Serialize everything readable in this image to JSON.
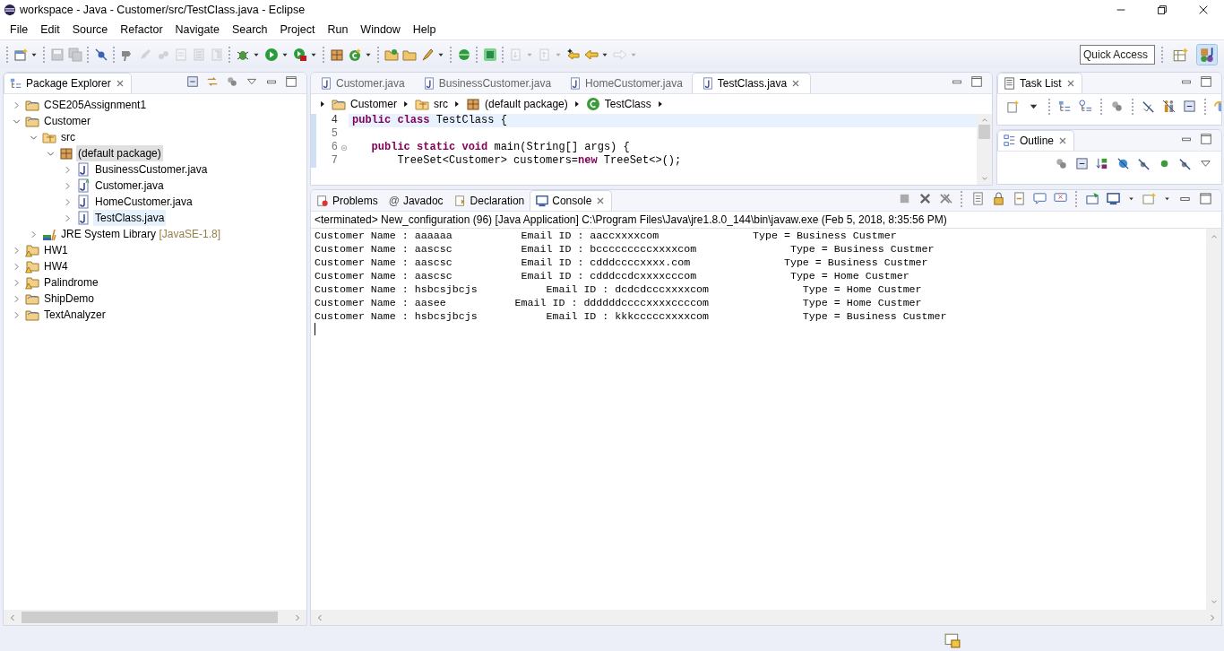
{
  "window": {
    "title": "workspace - Java - Customer/src/TestClass.java - Eclipse"
  },
  "menu": [
    "File",
    "Edit",
    "Source",
    "Refactor",
    "Navigate",
    "Search",
    "Project",
    "Run",
    "Window",
    "Help"
  ],
  "toolbar": [
    [
      {
        "kind": "new",
        "dropdown": true,
        "disabled": false
      }
    ],
    [
      {
        "kind": "save",
        "dropdown": false,
        "disabled": true
      },
      {
        "kind": "save-all",
        "dropdown": false,
        "disabled": true
      }
    ],
    [
      {
        "kind": "breakpoint",
        "dropdown": false,
        "disabled": false
      }
    ],
    [
      {
        "kind": "search",
        "dropdown": false,
        "disabled": false
      },
      {
        "kind": "pencil",
        "dropdown": false,
        "disabled": true
      },
      {
        "kind": "paw",
        "dropdown": false,
        "disabled": true
      },
      {
        "kind": "doc",
        "dropdown": false,
        "disabled": true
      },
      {
        "kind": "block",
        "dropdown": false,
        "disabled": true
      },
      {
        "kind": "pilcrow",
        "dropdown": false,
        "disabled": true
      }
    ],
    [
      {
        "kind": "debug",
        "dropdown": true,
        "disabled": false
      },
      {
        "kind": "run",
        "dropdown": true,
        "disabled": false
      },
      {
        "kind": "tool",
        "dropdown": true,
        "disabled": false
      }
    ],
    [
      {
        "kind": "package",
        "dropdown": false,
        "disabled": false
      },
      {
        "kind": "new-class",
        "dropdown": true,
        "disabled": false
      }
    ],
    [
      {
        "kind": "folder-open",
        "dropdown": false,
        "disabled": false
      },
      {
        "kind": "folder",
        "dropdown": false,
        "disabled": false
      },
      {
        "kind": "pen",
        "dropdown": true,
        "disabled": false
      }
    ],
    [
      {
        "kind": "globe",
        "dropdown": false,
        "disabled": false
      }
    ],
    [
      {
        "kind": "square",
        "dropdown": false,
        "disabled": false
      }
    ],
    [
      {
        "kind": "next",
        "dropdown": true,
        "disabled": true
      },
      {
        "kind": "prev",
        "dropdown": true,
        "disabled": true
      },
      {
        "kind": "last-edit",
        "dropdown": false,
        "disabled": false
      },
      {
        "kind": "back",
        "dropdown": true,
        "disabled": false
      },
      {
        "kind": "forward",
        "dropdown": true,
        "disabled": true
      }
    ]
  ],
  "quick_access": {
    "placeholder": "Quick Access"
  },
  "perspectives": [
    {
      "kind": "open-perspective",
      "selected": false
    },
    {
      "kind": "java",
      "selected": true
    }
  ],
  "package_explorer": {
    "title": "Package Explorer",
    "tree": [
      {
        "kind": "project",
        "label": "CSE205Assignment1",
        "expanded": false,
        "selected": false,
        "hovered": false
      },
      {
        "kind": "project",
        "label": "Customer",
        "expanded": true,
        "selected": false,
        "hovered": false,
        "children": [
          {
            "kind": "source-folder",
            "label": "src",
            "expanded": true,
            "selected": false,
            "hovered": false,
            "children": [
              {
                "kind": "package",
                "label": "(default package)",
                "expanded": true,
                "selected": true,
                "hovered": false,
                "children": [
                  {
                    "kind": "java-file",
                    "label": "BusinessCustomer.java",
                    "expanded": false,
                    "selected": false,
                    "hovered": false
                  },
                  {
                    "kind": "abstract-file",
                    "label": "Customer.java",
                    "expanded": false,
                    "selected": false,
                    "hovered": false
                  },
                  {
                    "kind": "java-file",
                    "label": "HomeCustomer.java",
                    "expanded": false,
                    "selected": false,
                    "hovered": false
                  },
                  {
                    "kind": "java-file",
                    "label": "TestClass.java",
                    "expanded": false,
                    "selected": false,
                    "hovered": true
                  }
                ]
              }
            ]
          },
          {
            "kind": "library",
            "label": "JRE System Library",
            "suffix": "[JavaSE-1.8]",
            "expanded": false,
            "selected": false,
            "hovered": false
          }
        ]
      },
      {
        "kind": "warning-project",
        "label": "HW1",
        "expanded": false,
        "selected": false,
        "hovered": false
      },
      {
        "kind": "warning-project",
        "label": "HW4",
        "expanded": false,
        "selected": false,
        "hovered": false
      },
      {
        "kind": "warning-project",
        "label": "Palindrome",
        "expanded": false,
        "selected": false,
        "hovered": false
      },
      {
        "kind": "project",
        "label": "ShipDemo",
        "expanded": false,
        "selected": false,
        "hovered": false
      },
      {
        "kind": "project",
        "label": "TextAnalyzer",
        "expanded": false,
        "selected": false,
        "hovered": false
      }
    ]
  },
  "editor": {
    "tabs": [
      {
        "label": "Customer.java",
        "selected": false
      },
      {
        "label": "BusinessCustomer.java",
        "selected": false
      },
      {
        "label": "HomeCustomer.java",
        "selected": false
      },
      {
        "label": "TestClass.java",
        "selected": true
      }
    ],
    "breadcrumb": [
      {
        "kind": "project",
        "label": "Customer"
      },
      {
        "kind": "source-folder",
        "label": "src"
      },
      {
        "kind": "package",
        "label": "(default package)"
      },
      {
        "kind": "class",
        "label": "TestClass"
      }
    ],
    "lines": [
      {
        "number": "4",
        "text": "**public** **class** TestClass {",
        "current": true,
        "fold": false
      },
      {
        "number": "5",
        "current": false,
        "fold": false
      },
      {
        "number": "6",
        "text": "   **public** **static** **void** main(String[] args) {",
        "current": false,
        "fold": true
      },
      {
        "number": "7",
        "text": "       TreeSet<Customer> customers=**new** TreeSet<>();",
        "current": false,
        "fold": false
      }
    ]
  },
  "task_list": {
    "title": "Task List"
  },
  "outline": {
    "title": "Outline"
  },
  "bottom_panel": {
    "tabs": [
      {
        "kind": "problems",
        "label": "Problems",
        "selected": false
      },
      {
        "kind": "javadoc",
        "icon": "@",
        "label": "Javadoc",
        "selected": false
      },
      {
        "kind": "declaration",
        "label": "Declaration",
        "selected": false
      },
      {
        "kind": "console",
        "label": "Console",
        "selected": true
      }
    ],
    "console": {
      "header": "<terminated> New_configuration (96) [Java Application] C:\\Program Files\\Java\\jre1.8.0_144\\bin\\javaw.exe (Feb 5, 2018, 8:35:56 PM)",
      "lines": [
        "Customer Name : aaaaaa           Email ID : aaccxxxxcom               Type = Business Custmer",
        "Customer Name : aascsc           Email ID : bcccccccccxxxxcom               Type = Business Custmer",
        "Customer Name : aascsc           Email ID : cdddccccxxxx.com               Type = Business Custmer",
        "Customer Name : aascsc           Email ID : cdddccdcxxxxcccom               Type = Home Custmer",
        "Customer Name : hsbcsjbcjs           Email ID : dcdcdcccxxxxcom               Type = Home Custmer",
        "Customer Name : aasee           Email ID : ddddddccccxxxxccccom               Type = Home Custmer",
        "Customer Name : hsbcsjbcjs           Email ID : kkkcccccxxxxcom               Type = Business Custmer"
      ]
    }
  }
}
